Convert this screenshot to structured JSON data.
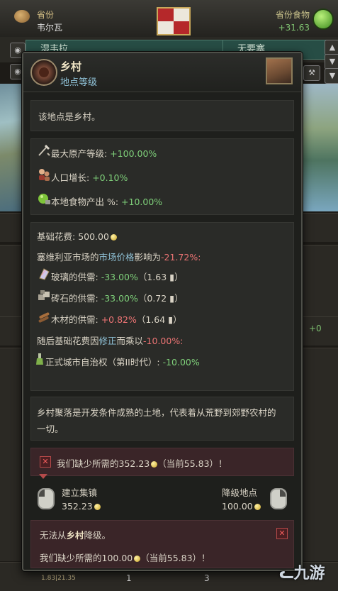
{
  "topbar": {
    "province_label": "省份",
    "province_name": "韦尔瓦",
    "food_label": "省份食物",
    "food_value": "+31.63"
  },
  "tabs": [
    "湿韦拉",
    "无要塞"
  ],
  "tooltip": {
    "title": "乡村",
    "subtitle": "地点等级",
    "intro": "该地点是乡村。",
    "modifiers": [
      {
        "label": "最大原产等级: ",
        "value": "+100.00%",
        "icon": "tools-icon"
      },
      {
        "label": "人口增长: ",
        "value": "+0.10%",
        "icon": "population-icon"
      },
      {
        "label": "本地食物产出 %: ",
        "value": "+10.00%",
        "icon": "food-icon"
      }
    ],
    "cost": {
      "base_label": "基础花费: ",
      "base_value": "500.00",
      "market_prefix": "塞维利亚市场的",
      "market_link": "市场价格",
      "market_suffix": "影响为",
      "market_value": "-21.72%:",
      "goods": [
        {
          "label": "玻璃的供需: ",
          "value": "-33.00%",
          "detail": "（1.63",
          "tail": "）",
          "icon": "glass-icon",
          "color": "neg"
        },
        {
          "label": "砖石的供需: ",
          "value": "-33.00%",
          "detail": "（0.72",
          "tail": "）",
          "icon": "stone-icon",
          "color": "neg"
        },
        {
          "label": "木材的供需: ",
          "value": "+0.82%",
          "detail": "（1.64",
          "tail": "）",
          "icon": "lumber-icon",
          "color": "pos"
        }
      ],
      "then_prefix": "随后基础花费因",
      "then_link": "修正",
      "then_suffix": "而乘以",
      "then_value": "-10.00%:",
      "rule_label": "正式城市自治权（第II时代）:",
      "rule_value": "-10.00%"
    },
    "description": "乡村聚落是开发条件成熟的土地，代表着从荒野到郊野农村的一切。",
    "description_lines": [
      "乡村聚落是开发条件成熟的土地，代表着从荒野到郊野农村的",
      "一切。"
    ],
    "missing_build": {
      "text": "我们缺少所需的",
      "amount": "352.23",
      "current": "（当前55.83）！"
    },
    "build": {
      "label": "建立集镇",
      "value": "352.23"
    },
    "downgrade": {
      "label": "降级地点",
      "value": "100.00"
    },
    "downgrade_block": {
      "prefix": "无法从",
      "name": "乡村",
      "suffix": "降级。",
      "missing_text": "我们缺少所需的",
      "amount": "100.00",
      "current": "（当前55.83）！"
    }
  },
  "bottom": {
    "frag": "1.83|21.35",
    "n1": "1",
    "n2": "3"
  },
  "right_panel_value": "+0",
  "watermark": "九游",
  "colors": {
    "positive": "#7fd07a",
    "negative": "#ec7474",
    "link": "#8fc1d6",
    "accent": "#efe4c5"
  }
}
